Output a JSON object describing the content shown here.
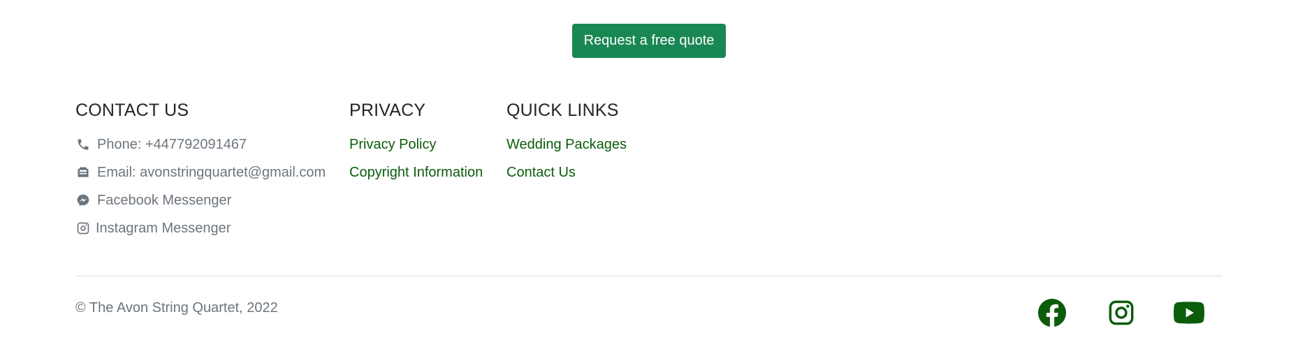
{
  "cta": {
    "label": "Request a free quote"
  },
  "contact": {
    "heading": "CONTACT US",
    "items": [
      {
        "icon": "phone-icon",
        "label": "Phone: +447792091467"
      },
      {
        "icon": "email-icon",
        "label": "Email: avonstringquartet@gmail.com"
      },
      {
        "icon": "messenger-icon",
        "label": "Facebook Messenger"
      },
      {
        "icon": "instagram-icon",
        "label": "Instagram Messenger"
      }
    ]
  },
  "privacy": {
    "heading": "PRIVACY",
    "links": [
      "Privacy Policy",
      "Copyright Information"
    ]
  },
  "quick_links": {
    "heading": "QUICK LINKS",
    "links": [
      "Wedding Packages",
      "Contact Us"
    ]
  },
  "copyright": "© The Avon String Quartet, 2022",
  "socials": [
    "facebook-icon",
    "instagram-icon",
    "youtube-icon"
  ],
  "colors": {
    "accent": "#198754",
    "link": "#0b5c0b",
    "muted": "#6c757d"
  }
}
